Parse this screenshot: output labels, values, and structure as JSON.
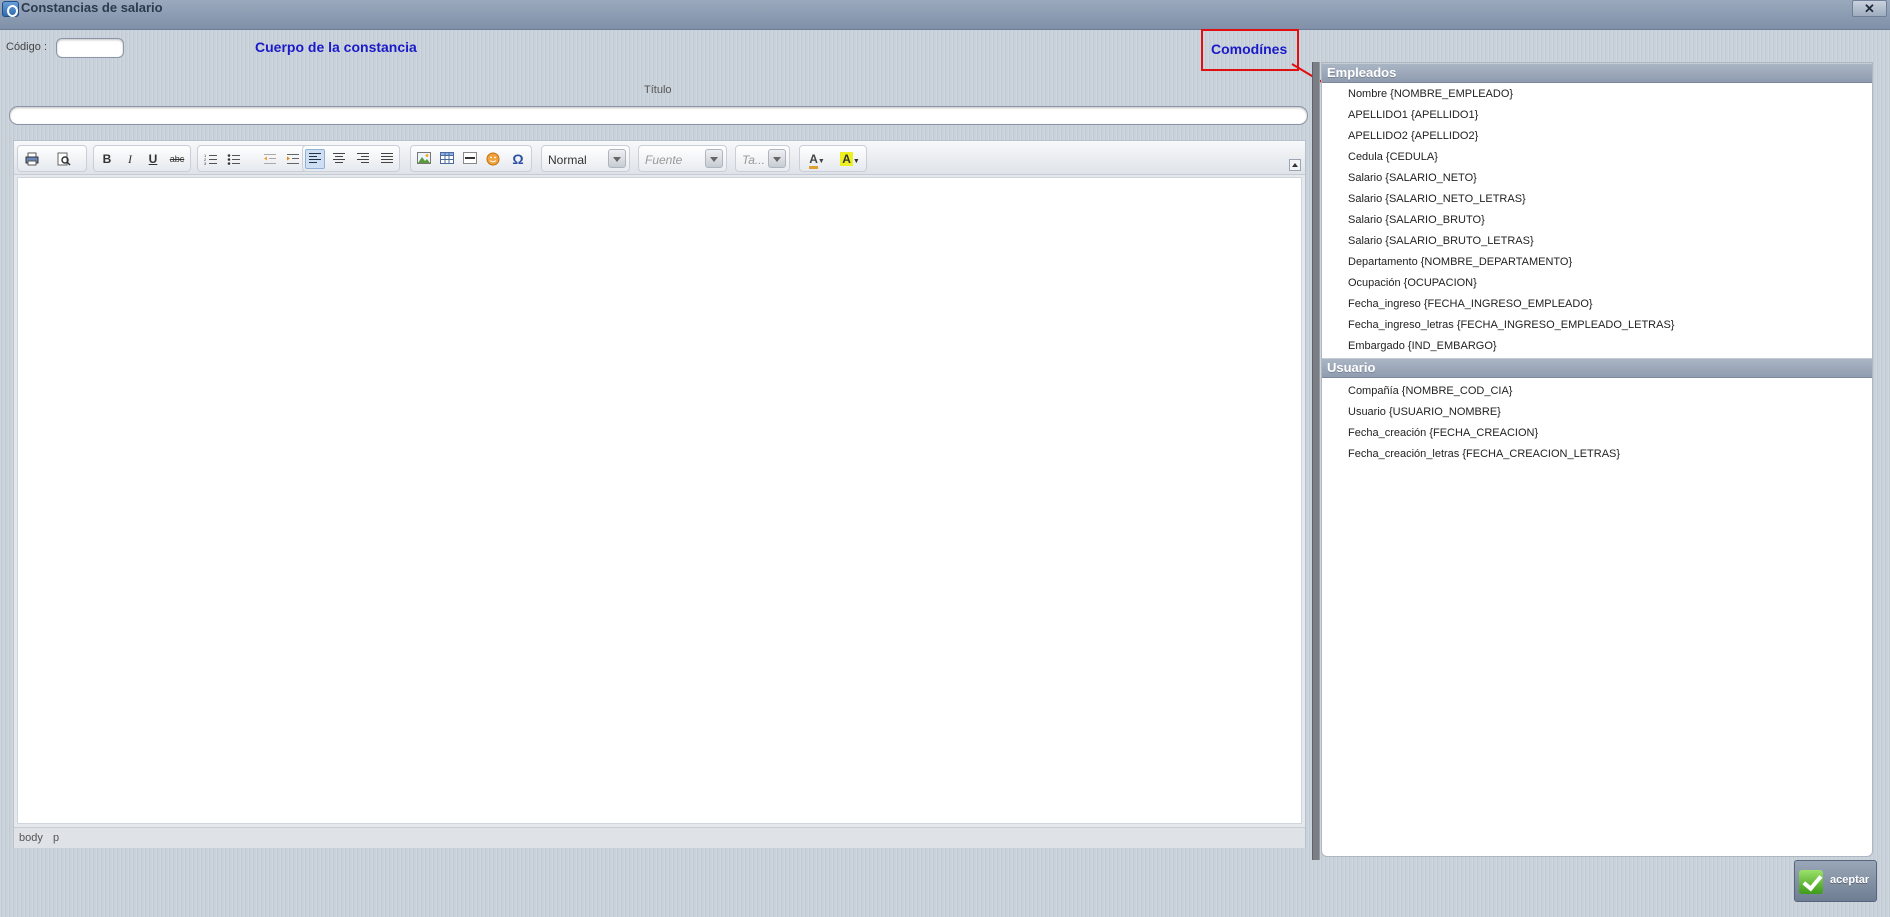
{
  "window": {
    "title": "Constancias de salario",
    "close_label": "✕"
  },
  "form": {
    "codigo_label": "Código :",
    "codigo_value": "",
    "cuerpo_label": "Cuerpo de la constancia",
    "titulo_label": "Título",
    "titulo_value": ""
  },
  "toolbar": {
    "format_value": "Normal",
    "font_placeholder": "Fuente",
    "size_placeholder": "Ta...",
    "bold_label": "B",
    "italic_label": "I",
    "underline_label": "U",
    "strike_label": "abc",
    "text_color_label": "A",
    "bg_color_label": "A",
    "special_char_label": "Ω"
  },
  "editor": {
    "path": [
      "body",
      "p"
    ]
  },
  "comodines": {
    "title": "Comodínes",
    "sections": [
      {
        "header": "Empleados",
        "items": [
          "Nombre {NOMBRE_EMPLEADO}",
          "APELLIDO1 {APELLIDO1}",
          "APELLIDO2 {APELLIDO2}",
          "Cedula {CEDULA}",
          "Salario {SALARIO_NETO}",
          "Salario {SALARIO_NETO_LETRAS}",
          "Salario {SALARIO_BRUTO}",
          "Salario {SALARIO_BRUTO_LETRAS}",
          "Departamento {NOMBRE_DEPARTAMENTO}",
          "Ocupación {OCUPACION}",
          "Fecha_ingreso {FECHA_INGRESO_EMPLEADO}",
          "Fecha_ingreso_letras {FECHA_INGRESO_EMPLEADO_LETRAS}",
          "Embargado {IND_EMBARGO}"
        ]
      },
      {
        "header": "Usuario",
        "items": [
          "Compañía {NOMBRE_COD_CIA}",
          "Usuario {USUARIO_NOMBRE}",
          "Fecha_creación {FECHA_CREACION}",
          "Fecha_creación_letras {FECHA_CREACION_LETRAS}"
        ]
      }
    ]
  },
  "actions": {
    "accept_label": "aceptar"
  },
  "colors": {
    "link_blue": "#1a1ac8",
    "highlight_red": "#e01010",
    "section_header": "#8f9cb0"
  }
}
